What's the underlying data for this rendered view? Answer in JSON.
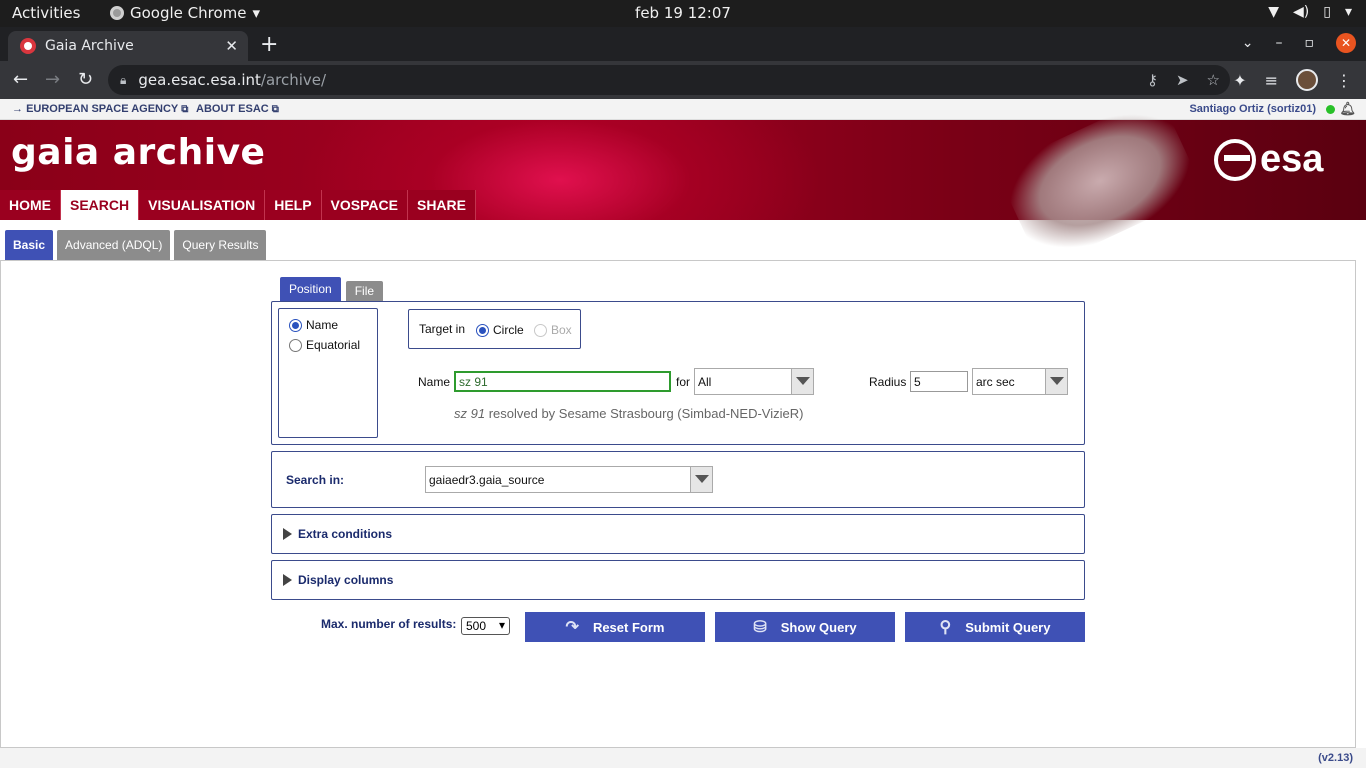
{
  "system": {
    "activities": "Activities",
    "app_name": "Google Chrome",
    "clock": "feb 19  12:07"
  },
  "browser": {
    "tab_title": "Gaia Archive",
    "url_host": "gea.esac.esa.int",
    "url_path": "/archive/"
  },
  "esa_bar": {
    "link1": "EUROPEAN SPACE AGENCY",
    "link2": "ABOUT ESAC",
    "user": "Santiago Ortiz (sortiz01)"
  },
  "banner": {
    "title": "gaia archive",
    "logo": "esa"
  },
  "nav": {
    "items": [
      "HOME",
      "SEARCH",
      "VISUALISATION",
      "HELP",
      "VOSPACE",
      "SHARE"
    ],
    "active": "SEARCH"
  },
  "subtabs": [
    "Basic",
    "Advanced (ADQL)",
    "Query Results"
  ],
  "position_tabs": [
    "Position",
    "File"
  ],
  "coord_type": {
    "name_label": "Name",
    "equatorial_label": "Equatorial",
    "selected": "Name"
  },
  "target": {
    "label": "Target in",
    "circle_label": "Circle",
    "box_label": "Box",
    "selected": "Circle"
  },
  "name_search": {
    "label": "Name",
    "value": "sz 91",
    "for_label": "for",
    "for_value": "All",
    "resolved_name": "sz 91",
    "resolved_text": "resolved by Sesame Strasbourg (Simbad-NED-VizieR)"
  },
  "radius": {
    "label": "Radius",
    "value": "5",
    "unit": "arc sec"
  },
  "search_in": {
    "label": "Search in:",
    "value": "gaiaedr3.gaia_source"
  },
  "sections": {
    "extra_conditions": "Extra conditions",
    "display_columns": "Display columns"
  },
  "footer_controls": {
    "max_results_label": "Max. number of results:",
    "max_results_value": "500",
    "reset_label": "Reset Form",
    "show_label": "Show Query",
    "submit_label": "Submit Query"
  },
  "version": "(v2.13)",
  "colors": {
    "nav_red": "#9a001f",
    "accent_blue": "#3f51b5",
    "focus_green": "#2e9b2e"
  }
}
